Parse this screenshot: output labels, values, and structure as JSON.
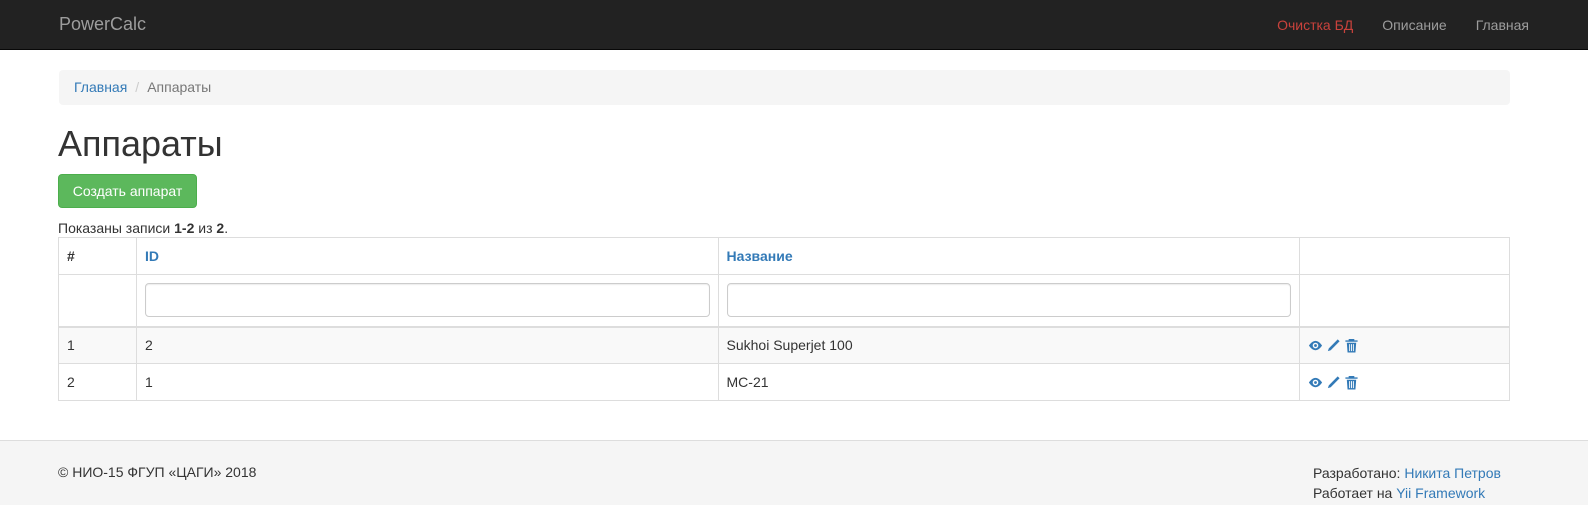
{
  "navbar": {
    "brand": "PowerCalc",
    "items": [
      {
        "label": "Очистка БД",
        "variant": "danger",
        "color": "#c9423c"
      },
      {
        "label": "Описание"
      },
      {
        "label": "Главная"
      }
    ]
  },
  "breadcrumb": {
    "home": "Главная",
    "separator": "/",
    "current": "Аппараты"
  },
  "page": {
    "title": "Аппараты",
    "create_button": "Создать аппарат"
  },
  "summary": {
    "prefix": "Показаны записи ",
    "range": "1-2",
    "middle": " из ",
    "total": "2",
    "suffix": "."
  },
  "grid": {
    "columns": [
      "#",
      "ID",
      "Название",
      ""
    ],
    "filters": {
      "id": "",
      "name": ""
    },
    "rows": [
      {
        "num": "1",
        "id": "2",
        "name": "Sukhoi Superjet 100"
      },
      {
        "num": "2",
        "id": "1",
        "name": "MC-21"
      }
    ],
    "action_icons": [
      "eye-icon",
      "pencil-icon",
      "trash-icon"
    ]
  },
  "footer": {
    "copyright": "© НИО-15 ФГУП «ЦАГИ» 2018",
    "developed_label": "Разработано: ",
    "developer": "Никита Петров",
    "powered_label": "Работает на ",
    "framework": "Yii Framework"
  },
  "colors": {
    "navbar_bg": "#222222",
    "link": "#337ab7",
    "success": "#5cb85c",
    "danger_link": "#c9423c"
  }
}
